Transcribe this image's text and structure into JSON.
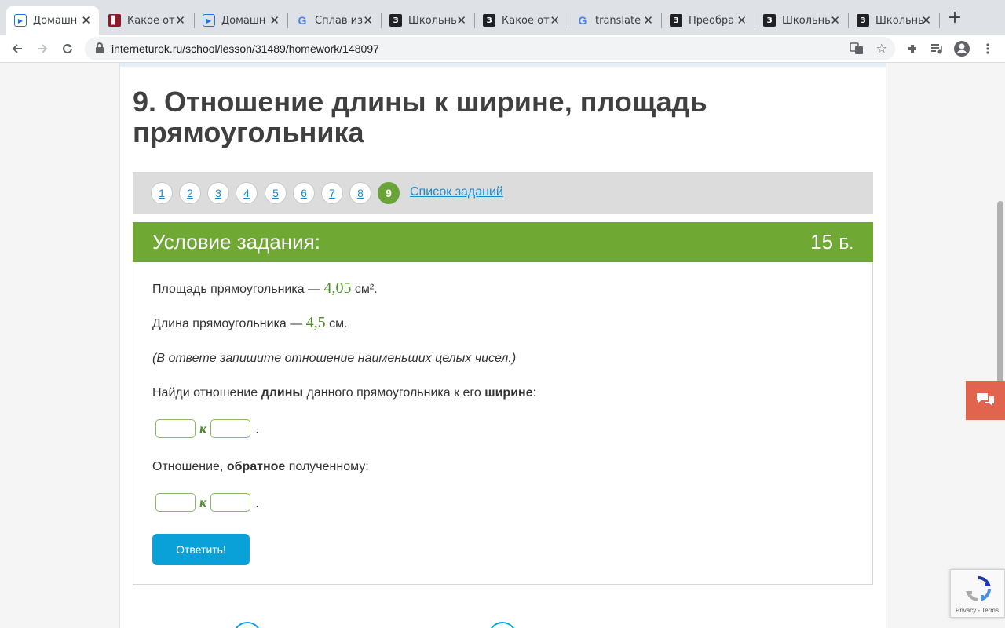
{
  "browser": {
    "tabs": [
      {
        "title": "Домашн",
        "icon": "play-icon"
      },
      {
        "title": "Какое от",
        "icon": "book-icon"
      },
      {
        "title": "Домашн",
        "icon": "play-icon"
      },
      {
        "title": "Сплав из",
        "icon": "google-icon"
      },
      {
        "title": "Школьны",
        "icon": "znanija-icon"
      },
      {
        "title": "Какое от",
        "icon": "znanija-icon"
      },
      {
        "title": "translate",
        "icon": "google-icon"
      },
      {
        "title": "Преобра",
        "icon": "znanija-icon"
      },
      {
        "title": "Школьны",
        "icon": "znanija-icon"
      },
      {
        "title": "Школьны",
        "icon": "znanija-icon"
      }
    ],
    "new_tab": "+",
    "url_host": "interneturok.ru",
    "url_path": "/school/lesson/31489/homework/148097"
  },
  "lesson": {
    "title": "9. Отношение длины к ширине, площадь прямоугольника"
  },
  "nav": {
    "numbers": [
      "1",
      "2",
      "3",
      "4",
      "5",
      "6",
      "7",
      "8",
      "9"
    ],
    "active": "9",
    "task_list": "Список заданий"
  },
  "condition": {
    "header": "Условие задания:",
    "points": "15",
    "points_unit": "Б.",
    "area_prefix": "Площадь прямоугольника — ",
    "area_value": "4,05",
    "area_unit": " см².",
    "length_prefix": "Длина прямоугольника — ",
    "length_value": "4,5",
    "length_unit": " см.",
    "hint": "(В ответе запишите отношение наименьших целых чисел.)",
    "q1_part1": "Найди отношение ",
    "q1_bold1": "длины",
    "q1_part2": " данного прямоугольника к его ",
    "q1_bold2": "ширине",
    "q1_part3": ":",
    "k_label": "к",
    "dot": ".",
    "q2_part1": "Отношение, ",
    "q2_bold": "обратное",
    "q2_part2": " полученному:",
    "submit": "Ответить!"
  },
  "recaptcha": {
    "links": "Privacy - Terms"
  },
  "colors": {
    "green": "#6fa832",
    "blue": "#0aa0d8",
    "chat": "#e0644e"
  }
}
